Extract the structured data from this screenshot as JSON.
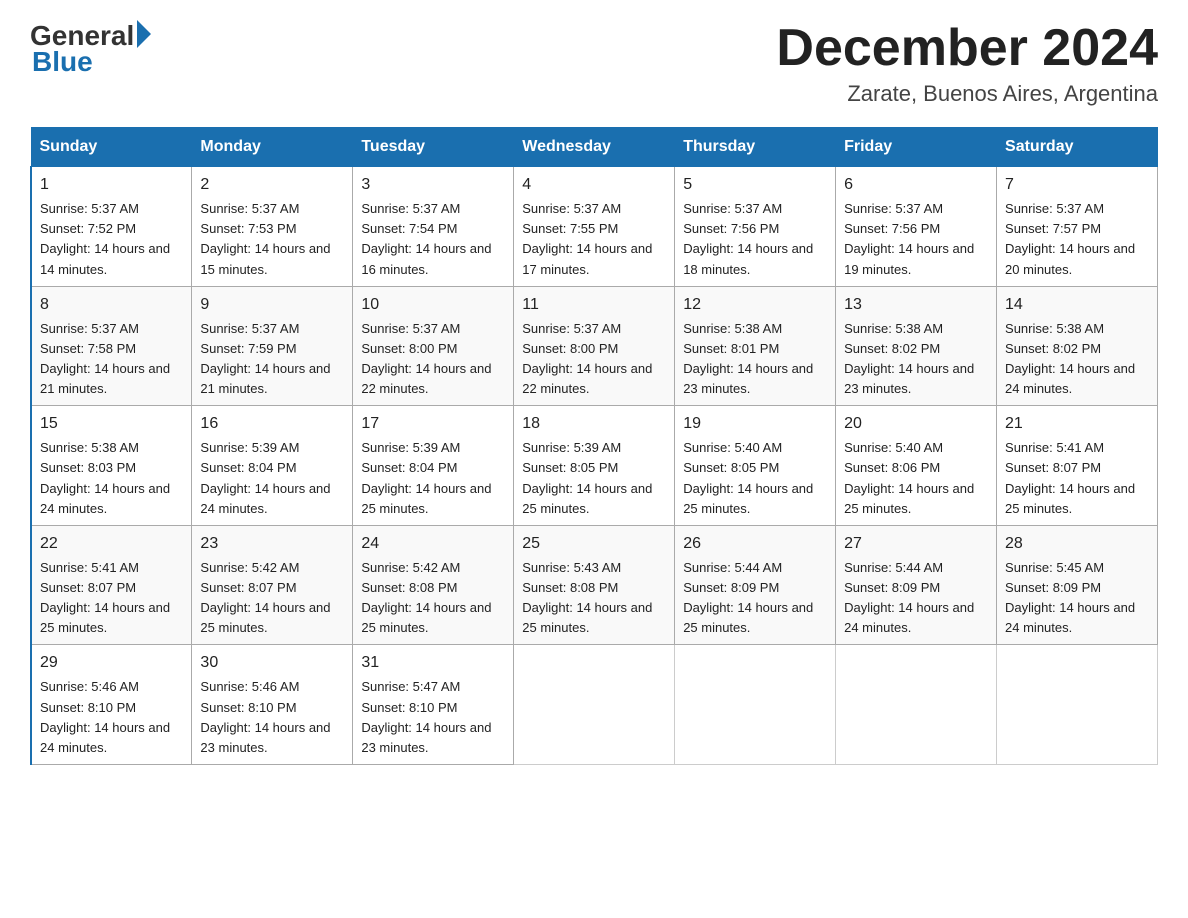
{
  "header": {
    "logo_general": "General",
    "logo_blue": "Blue",
    "month_title": "December 2024",
    "location": "Zarate, Buenos Aires, Argentina"
  },
  "days_of_week": [
    "Sunday",
    "Monday",
    "Tuesday",
    "Wednesday",
    "Thursday",
    "Friday",
    "Saturday"
  ],
  "weeks": [
    [
      {
        "day": "1",
        "sunrise": "5:37 AM",
        "sunset": "7:52 PM",
        "daylight": "14 hours and 14 minutes."
      },
      {
        "day": "2",
        "sunrise": "5:37 AM",
        "sunset": "7:53 PM",
        "daylight": "14 hours and 15 minutes."
      },
      {
        "day": "3",
        "sunrise": "5:37 AM",
        "sunset": "7:54 PM",
        "daylight": "14 hours and 16 minutes."
      },
      {
        "day": "4",
        "sunrise": "5:37 AM",
        "sunset": "7:55 PM",
        "daylight": "14 hours and 17 minutes."
      },
      {
        "day": "5",
        "sunrise": "5:37 AM",
        "sunset": "7:56 PM",
        "daylight": "14 hours and 18 minutes."
      },
      {
        "day": "6",
        "sunrise": "5:37 AM",
        "sunset": "7:56 PM",
        "daylight": "14 hours and 19 minutes."
      },
      {
        "day": "7",
        "sunrise": "5:37 AM",
        "sunset": "7:57 PM",
        "daylight": "14 hours and 20 minutes."
      }
    ],
    [
      {
        "day": "8",
        "sunrise": "5:37 AM",
        "sunset": "7:58 PM",
        "daylight": "14 hours and 21 minutes."
      },
      {
        "day": "9",
        "sunrise": "5:37 AM",
        "sunset": "7:59 PM",
        "daylight": "14 hours and 21 minutes."
      },
      {
        "day": "10",
        "sunrise": "5:37 AM",
        "sunset": "8:00 PM",
        "daylight": "14 hours and 22 minutes."
      },
      {
        "day": "11",
        "sunrise": "5:37 AM",
        "sunset": "8:00 PM",
        "daylight": "14 hours and 22 minutes."
      },
      {
        "day": "12",
        "sunrise": "5:38 AM",
        "sunset": "8:01 PM",
        "daylight": "14 hours and 23 minutes."
      },
      {
        "day": "13",
        "sunrise": "5:38 AM",
        "sunset": "8:02 PM",
        "daylight": "14 hours and 23 minutes."
      },
      {
        "day": "14",
        "sunrise": "5:38 AM",
        "sunset": "8:02 PM",
        "daylight": "14 hours and 24 minutes."
      }
    ],
    [
      {
        "day": "15",
        "sunrise": "5:38 AM",
        "sunset": "8:03 PM",
        "daylight": "14 hours and 24 minutes."
      },
      {
        "day": "16",
        "sunrise": "5:39 AM",
        "sunset": "8:04 PM",
        "daylight": "14 hours and 24 minutes."
      },
      {
        "day": "17",
        "sunrise": "5:39 AM",
        "sunset": "8:04 PM",
        "daylight": "14 hours and 25 minutes."
      },
      {
        "day": "18",
        "sunrise": "5:39 AM",
        "sunset": "8:05 PM",
        "daylight": "14 hours and 25 minutes."
      },
      {
        "day": "19",
        "sunrise": "5:40 AM",
        "sunset": "8:05 PM",
        "daylight": "14 hours and 25 minutes."
      },
      {
        "day": "20",
        "sunrise": "5:40 AM",
        "sunset": "8:06 PM",
        "daylight": "14 hours and 25 minutes."
      },
      {
        "day": "21",
        "sunrise": "5:41 AM",
        "sunset": "8:07 PM",
        "daylight": "14 hours and 25 minutes."
      }
    ],
    [
      {
        "day": "22",
        "sunrise": "5:41 AM",
        "sunset": "8:07 PM",
        "daylight": "14 hours and 25 minutes."
      },
      {
        "day": "23",
        "sunrise": "5:42 AM",
        "sunset": "8:07 PM",
        "daylight": "14 hours and 25 minutes."
      },
      {
        "day": "24",
        "sunrise": "5:42 AM",
        "sunset": "8:08 PM",
        "daylight": "14 hours and 25 minutes."
      },
      {
        "day": "25",
        "sunrise": "5:43 AM",
        "sunset": "8:08 PM",
        "daylight": "14 hours and 25 minutes."
      },
      {
        "day": "26",
        "sunrise": "5:44 AM",
        "sunset": "8:09 PM",
        "daylight": "14 hours and 25 minutes."
      },
      {
        "day": "27",
        "sunrise": "5:44 AM",
        "sunset": "8:09 PM",
        "daylight": "14 hours and 24 minutes."
      },
      {
        "day": "28",
        "sunrise": "5:45 AM",
        "sunset": "8:09 PM",
        "daylight": "14 hours and 24 minutes."
      }
    ],
    [
      {
        "day": "29",
        "sunrise": "5:46 AM",
        "sunset": "8:10 PM",
        "daylight": "14 hours and 24 minutes."
      },
      {
        "day": "30",
        "sunrise": "5:46 AM",
        "sunset": "8:10 PM",
        "daylight": "14 hours and 23 minutes."
      },
      {
        "day": "31",
        "sunrise": "5:47 AM",
        "sunset": "8:10 PM",
        "daylight": "14 hours and 23 minutes."
      },
      null,
      null,
      null,
      null
    ]
  ]
}
